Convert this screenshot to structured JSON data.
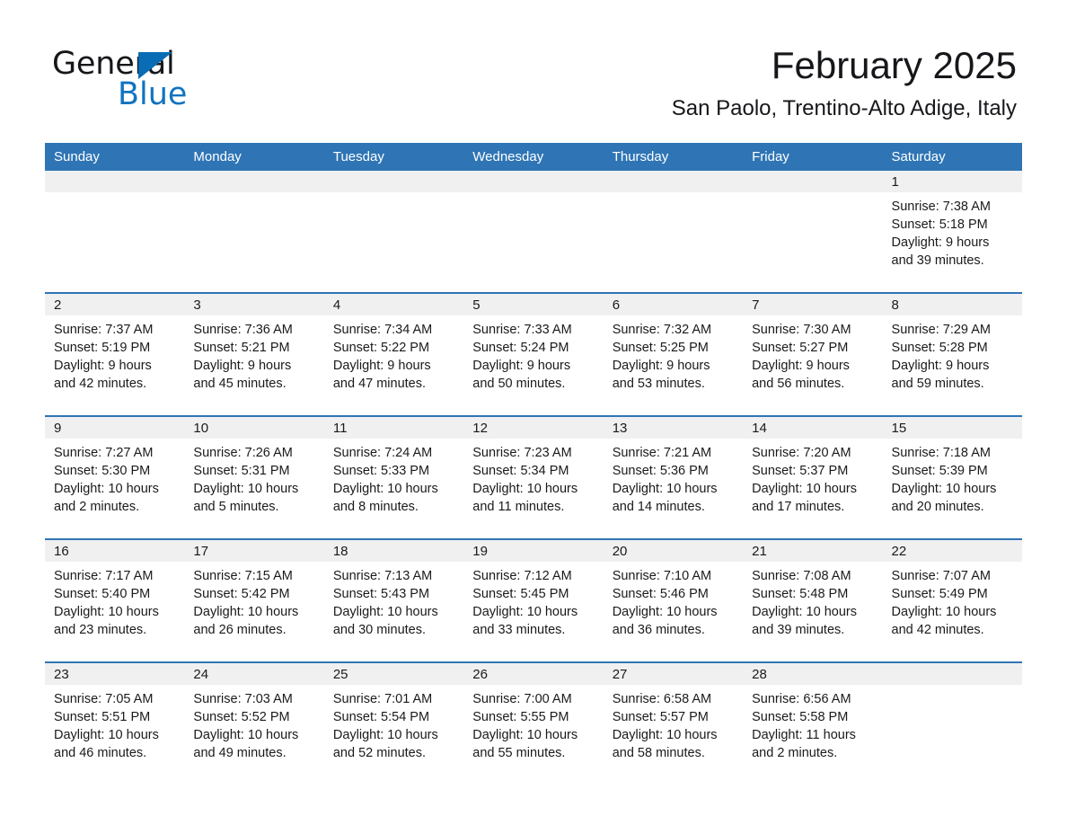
{
  "brand": {
    "name_part1": "General",
    "name_part2": "Blue",
    "triangle_color": "#0a6cb4",
    "blue_color": "#1173c0"
  },
  "header": {
    "month_title": "February 2025",
    "location": "San Paolo, Trentino-Alto Adige, Italy"
  },
  "theme": {
    "header_blue": "#2f75b5",
    "daynum_band": "#f0f0f0",
    "text": "#1a1a1a"
  },
  "calendar": {
    "weekday_headers": [
      "Sunday",
      "Monday",
      "Tuesday",
      "Wednesday",
      "Thursday",
      "Friday",
      "Saturday"
    ],
    "weeks": [
      [
        {
          "day": "",
          "lines": []
        },
        {
          "day": "",
          "lines": []
        },
        {
          "day": "",
          "lines": []
        },
        {
          "day": "",
          "lines": []
        },
        {
          "day": "",
          "lines": []
        },
        {
          "day": "",
          "lines": []
        },
        {
          "day": "1",
          "lines": [
            "Sunrise: 7:38 AM",
            "Sunset: 5:18 PM",
            "Daylight: 9 hours",
            "and 39 minutes."
          ]
        }
      ],
      [
        {
          "day": "2",
          "lines": [
            "Sunrise: 7:37 AM",
            "Sunset: 5:19 PM",
            "Daylight: 9 hours",
            "and 42 minutes."
          ]
        },
        {
          "day": "3",
          "lines": [
            "Sunrise: 7:36 AM",
            "Sunset: 5:21 PM",
            "Daylight: 9 hours",
            "and 45 minutes."
          ]
        },
        {
          "day": "4",
          "lines": [
            "Sunrise: 7:34 AM",
            "Sunset: 5:22 PM",
            "Daylight: 9 hours",
            "and 47 minutes."
          ]
        },
        {
          "day": "5",
          "lines": [
            "Sunrise: 7:33 AM",
            "Sunset: 5:24 PM",
            "Daylight: 9 hours",
            "and 50 minutes."
          ]
        },
        {
          "day": "6",
          "lines": [
            "Sunrise: 7:32 AM",
            "Sunset: 5:25 PM",
            "Daylight: 9 hours",
            "and 53 minutes."
          ]
        },
        {
          "day": "7",
          "lines": [
            "Sunrise: 7:30 AM",
            "Sunset: 5:27 PM",
            "Daylight: 9 hours",
            "and 56 minutes."
          ]
        },
        {
          "day": "8",
          "lines": [
            "Sunrise: 7:29 AM",
            "Sunset: 5:28 PM",
            "Daylight: 9 hours",
            "and 59 minutes."
          ]
        }
      ],
      [
        {
          "day": "9",
          "lines": [
            "Sunrise: 7:27 AM",
            "Sunset: 5:30 PM",
            "Daylight: 10 hours",
            "and 2 minutes."
          ]
        },
        {
          "day": "10",
          "lines": [
            "Sunrise: 7:26 AM",
            "Sunset: 5:31 PM",
            "Daylight: 10 hours",
            "and 5 minutes."
          ]
        },
        {
          "day": "11",
          "lines": [
            "Sunrise: 7:24 AM",
            "Sunset: 5:33 PM",
            "Daylight: 10 hours",
            "and 8 minutes."
          ]
        },
        {
          "day": "12",
          "lines": [
            "Sunrise: 7:23 AM",
            "Sunset: 5:34 PM",
            "Daylight: 10 hours",
            "and 11 minutes."
          ]
        },
        {
          "day": "13",
          "lines": [
            "Sunrise: 7:21 AM",
            "Sunset: 5:36 PM",
            "Daylight: 10 hours",
            "and 14 minutes."
          ]
        },
        {
          "day": "14",
          "lines": [
            "Sunrise: 7:20 AM",
            "Sunset: 5:37 PM",
            "Daylight: 10 hours",
            "and 17 minutes."
          ]
        },
        {
          "day": "15",
          "lines": [
            "Sunrise: 7:18 AM",
            "Sunset: 5:39 PM",
            "Daylight: 10 hours",
            "and 20 minutes."
          ]
        }
      ],
      [
        {
          "day": "16",
          "lines": [
            "Sunrise: 7:17 AM",
            "Sunset: 5:40 PM",
            "Daylight: 10 hours",
            "and 23 minutes."
          ]
        },
        {
          "day": "17",
          "lines": [
            "Sunrise: 7:15 AM",
            "Sunset: 5:42 PM",
            "Daylight: 10 hours",
            "and 26 minutes."
          ]
        },
        {
          "day": "18",
          "lines": [
            "Sunrise: 7:13 AM",
            "Sunset: 5:43 PM",
            "Daylight: 10 hours",
            "and 30 minutes."
          ]
        },
        {
          "day": "19",
          "lines": [
            "Sunrise: 7:12 AM",
            "Sunset: 5:45 PM",
            "Daylight: 10 hours",
            "and 33 minutes."
          ]
        },
        {
          "day": "20",
          "lines": [
            "Sunrise: 7:10 AM",
            "Sunset: 5:46 PM",
            "Daylight: 10 hours",
            "and 36 minutes."
          ]
        },
        {
          "day": "21",
          "lines": [
            "Sunrise: 7:08 AM",
            "Sunset: 5:48 PM",
            "Daylight: 10 hours",
            "and 39 minutes."
          ]
        },
        {
          "day": "22",
          "lines": [
            "Sunrise: 7:07 AM",
            "Sunset: 5:49 PM",
            "Daylight: 10 hours",
            "and 42 minutes."
          ]
        }
      ],
      [
        {
          "day": "23",
          "lines": [
            "Sunrise: 7:05 AM",
            "Sunset: 5:51 PM",
            "Daylight: 10 hours",
            "and 46 minutes."
          ]
        },
        {
          "day": "24",
          "lines": [
            "Sunrise: 7:03 AM",
            "Sunset: 5:52 PM",
            "Daylight: 10 hours",
            "and 49 minutes."
          ]
        },
        {
          "day": "25",
          "lines": [
            "Sunrise: 7:01 AM",
            "Sunset: 5:54 PM",
            "Daylight: 10 hours",
            "and 52 minutes."
          ]
        },
        {
          "day": "26",
          "lines": [
            "Sunrise: 7:00 AM",
            "Sunset: 5:55 PM",
            "Daylight: 10 hours",
            "and 55 minutes."
          ]
        },
        {
          "day": "27",
          "lines": [
            "Sunrise: 6:58 AM",
            "Sunset: 5:57 PM",
            "Daylight: 10 hours",
            "and 58 minutes."
          ]
        },
        {
          "day": "28",
          "lines": [
            "Sunrise: 6:56 AM",
            "Sunset: 5:58 PM",
            "Daylight: 11 hours",
            "and 2 minutes."
          ]
        },
        {
          "day": "",
          "lines": []
        }
      ]
    ]
  }
}
